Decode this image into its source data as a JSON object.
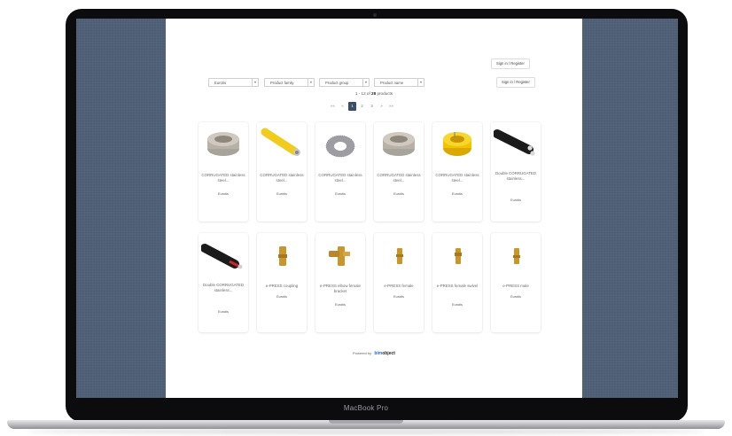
{
  "device": {
    "model_label": "MacBook Pro"
  },
  "header": {
    "signin_top": "Sign in / Register",
    "signin_right": "Sign in / Register"
  },
  "filters": [
    {
      "value": "Eurotis"
    },
    {
      "value": "Product family"
    },
    {
      "value": "Product group"
    },
    {
      "value": "Product name"
    }
  ],
  "results": {
    "prefix": "1 - 12 of ",
    "total": "28",
    "suffix": " products"
  },
  "pagination": {
    "items": [
      "««",
      "«",
      "1",
      "2",
      "3",
      "»",
      "»»"
    ],
    "active": "1"
  },
  "products": [
    {
      "name": "CORRUGATED stainless steel...",
      "brand": "Eurotis",
      "image": "grey-coil-pipe"
    },
    {
      "name": "CORRUGATED stainless steel...",
      "brand": "Eurotis",
      "image": "yellow-pipe"
    },
    {
      "name": "CORRUGATED stainless steel...",
      "brand": "Eurotis",
      "image": "steel-coil"
    },
    {
      "name": "CORRUGATED stainless steel...",
      "brand": "Eurotis",
      "image": "grey-coil-pipe"
    },
    {
      "name": "CORRUGATED stainless steel...",
      "brand": "Eurotis",
      "image": "yellow-coil"
    },
    {
      "name": "Double CORRUGATED stainless...",
      "brand": "Eurotis",
      "image": "black-double-pipe"
    },
    {
      "name": "Double CORRUGATED stainless...",
      "brand": "Eurotis",
      "image": "black-red-pipe"
    },
    {
      "name": "e-PRESS coupling",
      "brand": "Eurotis",
      "image": "brass-coupling"
    },
    {
      "name": "e-PRESS elbow female bracket",
      "brand": "Eurotis",
      "image": "brass-elbow"
    },
    {
      "name": "e-PRESS female",
      "brand": "Eurotis",
      "image": "brass-female"
    },
    {
      "name": "e-PRESS female swivel",
      "brand": "Eurotis",
      "image": "brass-swivel"
    },
    {
      "name": "e-PRESS male",
      "brand": "Eurotis",
      "image": "brass-male"
    }
  ],
  "footer": {
    "powered_by": "Powered by",
    "logo_text": "bimobject"
  },
  "colors": {
    "screen_background": "#4f6077",
    "active_page": "#3a4f67",
    "logo_accent": "#1f6fd0"
  }
}
